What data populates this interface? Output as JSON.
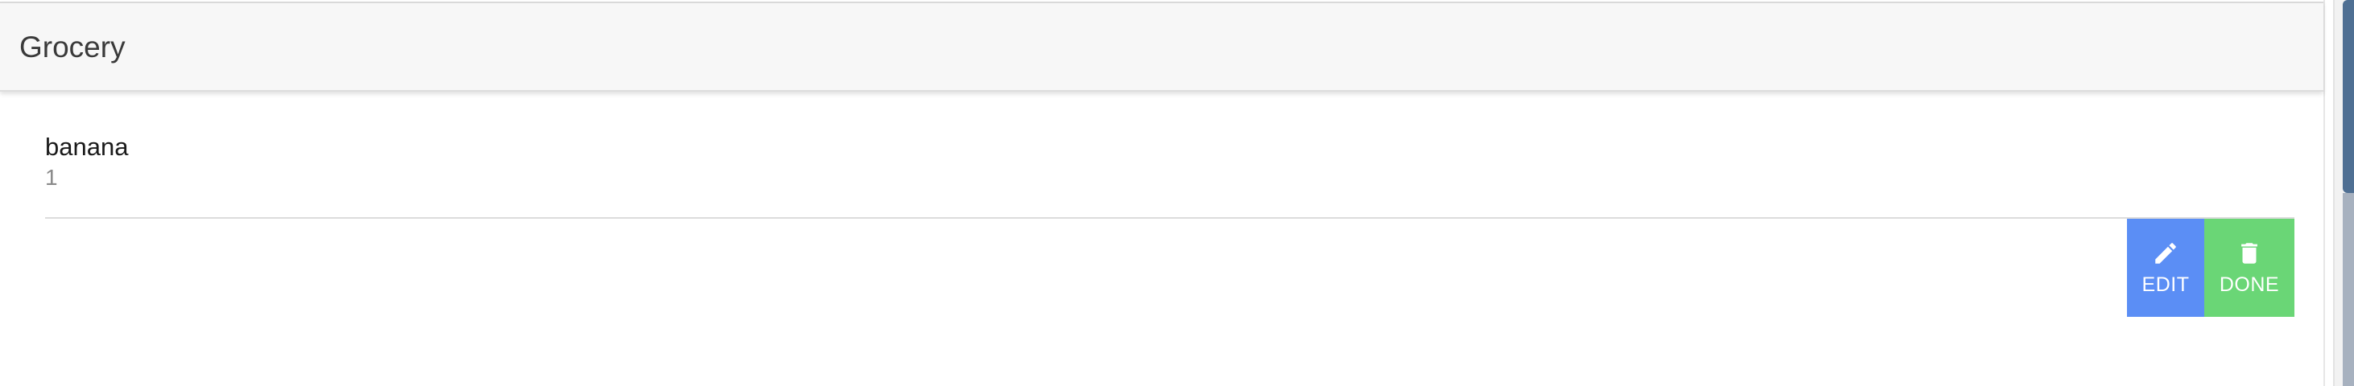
{
  "toolbar": {
    "title": "Grocery"
  },
  "list": {
    "items": [
      {
        "name": "banana",
        "quantity": "1"
      }
    ]
  },
  "item_actions": {
    "edit_label": "EDIT",
    "edit_icon": "pencil-icon",
    "done_label": "DONE",
    "done_icon": "trash-icon"
  },
  "colors": {
    "edit_button": "#5b8ef5",
    "done_button": "#6ad676",
    "toolbar_background": "#f7f7f7",
    "scrollbar_thumb": "#4f6f93"
  }
}
